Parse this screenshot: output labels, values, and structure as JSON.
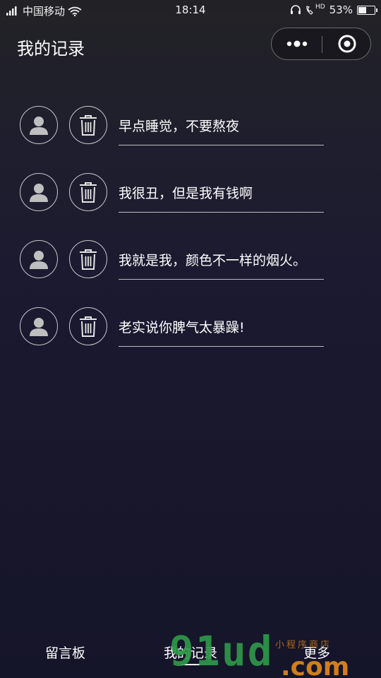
{
  "status_bar": {
    "carrier": "中国移动",
    "time": "18:14",
    "battery": "53%",
    "battery_level": 0.53,
    "network": "HD"
  },
  "header": {
    "title": "我的记录",
    "more_icon": "more-dots-icon",
    "close_icon": "target-circle-icon"
  },
  "records": [
    {
      "text": "早点睡觉，不要熬夜"
    },
    {
      "text": "我很丑，但是我有钱啊"
    },
    {
      "text": "我就是我，颜色不一样的烟火。"
    },
    {
      "text": "老实说你脾气太暴躁!"
    }
  ],
  "tabs": [
    {
      "label": "留言板"
    },
    {
      "label": "我的记录",
      "active": true
    },
    {
      "label": "更多"
    }
  ],
  "watermark": {
    "main": "91ud",
    "suffix": ".com",
    "small": "小程序商店"
  },
  "colors": {
    "background_top": "#222226",
    "background_bottom": "#15152a",
    "text": "#ffffff",
    "watermark_green": "#2f9a4a",
    "watermark_orange": "#e88a1a"
  }
}
